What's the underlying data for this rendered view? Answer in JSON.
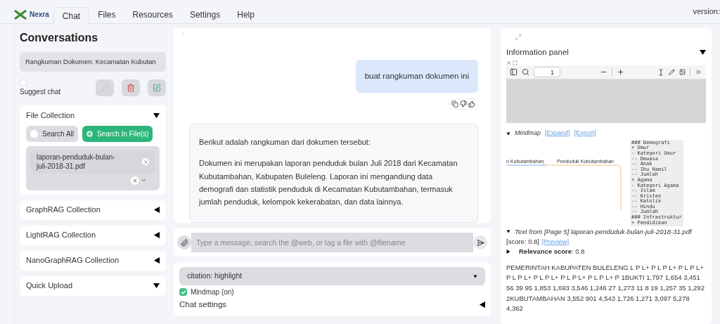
{
  "brand": "Nexra",
  "tabs": [
    {
      "label": "Chat",
      "selected": true
    },
    {
      "label": "Files",
      "selected": false
    },
    {
      "label": "Resources",
      "selected": false
    },
    {
      "label": "Settings",
      "selected": false
    },
    {
      "label": "Help",
      "selected": false
    }
  ],
  "version": "version:",
  "sidebar": {
    "title": "Conversations",
    "conversation": "Rangkuman Dokumen: Kecamatan Kubutan",
    "suggest_chat": {
      "label": "Suggest chat",
      "checked": false
    },
    "file_collection": {
      "title": "File Collection",
      "expanded": true,
      "options": [
        {
          "label": "Search All",
          "selected": false
        },
        {
          "label": "Search In File(s)",
          "selected": true
        }
      ],
      "files": [
        "laporan-penduduk-bulan-juli-2018-31.pdf"
      ]
    },
    "sections": [
      {
        "title": "GraphRAG Collection",
        "expanded": false
      },
      {
        "title": "LightRAG Collection",
        "expanded": false
      },
      {
        "title": "NanoGraphRAG Collection",
        "expanded": false
      },
      {
        "title": "Quick Upload",
        "expanded": true
      }
    ]
  },
  "chat": {
    "messages": [
      {
        "kind": "user",
        "paragraphs": [
          "buat rangkuman dokumen ini"
        ]
      },
      {
        "kind": "assistant",
        "paragraphs": [
          "Berikut adalah rangkuman dari dokumen tersebut:",
          "Dokumen ini merupakan laporan penduduk bulan Juli 2018 dari Kecamatan Kubutambahan, Kabupaten Buleleng. Laporan ini mengandung data demografi dan statistik penduduk di Kecamatan Kubutambahan, termasuk jumlah penduduk, kelompok kekerabatan, dan data lainnya."
        ]
      }
    ],
    "input": {
      "placeholder": "Type a message, search the @web, or tag a file with @filename"
    },
    "citation": "citation: highlight",
    "mindmap": {
      "label": "Mindmap (on)",
      "checked": true
    },
    "settings": {
      "title": "Chat settings",
      "expanded": false
    }
  },
  "info_panel": {
    "title": "Information panel",
    "expanded": true,
    "page": "1",
    "mindmap": {
      "title": "Mindmap",
      "links": [
        "[Expand]",
        "[Export]"
      ],
      "nodes": [
        "n Kubutambahan",
        "Penduduk Kubutambahan"
      ],
      "outline": [
        "### Demografi",
        "+ Umur",
        "- Kategori Umur",
        "-- Dewasa",
        "-- Anak",
        "-- Ibu Hamil",
        "-- Jumlah",
        "+ Agama",
        "- Kategori Agama",
        "-- Islam",
        "-- Kristen",
        "-- Katolik",
        "-- Hindu",
        "-- Jumlah",
        "### Infrastruktur",
        "+ Pendidikan"
      ]
    },
    "source": {
      "title": "Text from [Page 5] laporan-penduduk-bulan-juli-2018-31.pdf",
      "score": "[score: 0.8]",
      "preview": "[Preview]",
      "relevance_label": "Relevance score",
      "relevance_value": ": 0.8",
      "text": "PEMERINTAH KABUPATEN BULELENG L P L+ P L P L+ P L P L+ P L P L+ P L P L+ P L P L+ P L P L+ P 1BUKTI 1,797 1,654 3,451 56 39 95 1,853 1,693 3,546 1,246 27 1,273 11 8 19 1,257 35 1,292 2KUBUTAMBAHAN 3,552 901 4,543 1,726 1,271 3,097 5,278 4,362"
    }
  }
}
